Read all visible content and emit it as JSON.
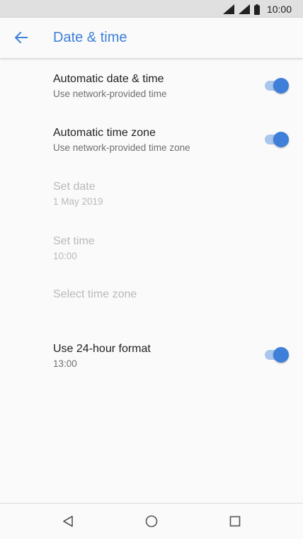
{
  "status_bar": {
    "time": "10:00",
    "icons": [
      "wifi-signal-icon",
      "cell-signal-icon",
      "battery-icon"
    ]
  },
  "app_bar": {
    "title": "Date & time",
    "back_icon": "arrow-back-icon",
    "accent_color": "#3d7fd9"
  },
  "settings": [
    {
      "title": "Automatic date & time",
      "summary": "Use network-provided time",
      "enabled": true,
      "toggle": true,
      "checked": true
    },
    {
      "title": "Automatic time zone",
      "summary": "Use network-provided time zone",
      "enabled": true,
      "toggle": true,
      "checked": true
    },
    {
      "title": "Set date",
      "summary": "1 May 2019",
      "enabled": false,
      "toggle": false
    },
    {
      "title": "Set time",
      "summary": "10:00",
      "enabled": false,
      "toggle": false
    },
    {
      "title": "Select time zone",
      "enabled": false,
      "toggle": false
    },
    {
      "title": "Use 24-hour format",
      "summary": "13:00",
      "enabled": true,
      "toggle": true,
      "checked": true
    }
  ],
  "nav_bar": {
    "icons": [
      "back-triangle-icon",
      "home-circle-icon",
      "recents-square-icon"
    ]
  }
}
